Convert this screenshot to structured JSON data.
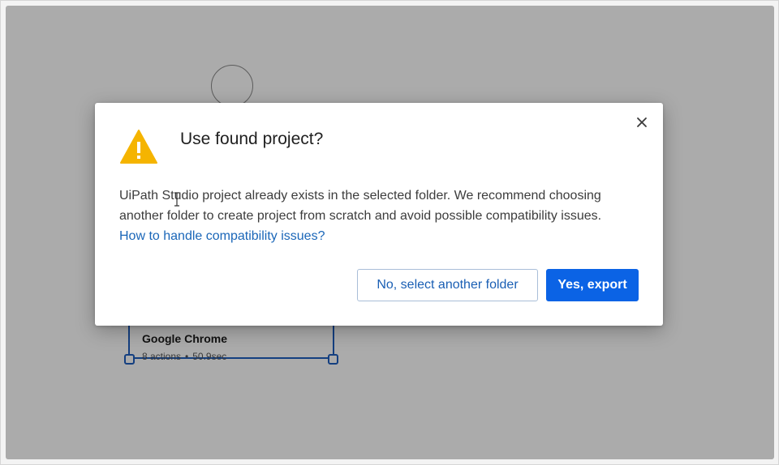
{
  "background": {
    "step_card": {
      "title": "Google Chrome",
      "actions": "8 actions",
      "separator": "•",
      "duration": "50.9sec"
    }
  },
  "dialog": {
    "title": "Use found project?",
    "message": "UiPath Studio project already exists in the selected folder. We recommend choosing another folder to create project from scratch and avoid possible compatibility issues.",
    "link_text": "How to handle compatibility issues?",
    "close_icon": "close-icon",
    "warning_icon": "warning-triangle-icon",
    "secondary_button": "No, select another folder",
    "primary_button": "Yes, export"
  },
  "colors": {
    "primary": "#0b63e5",
    "link": "#1a66b8",
    "warning": "#f5b400",
    "selection": "#1f5fbf"
  }
}
